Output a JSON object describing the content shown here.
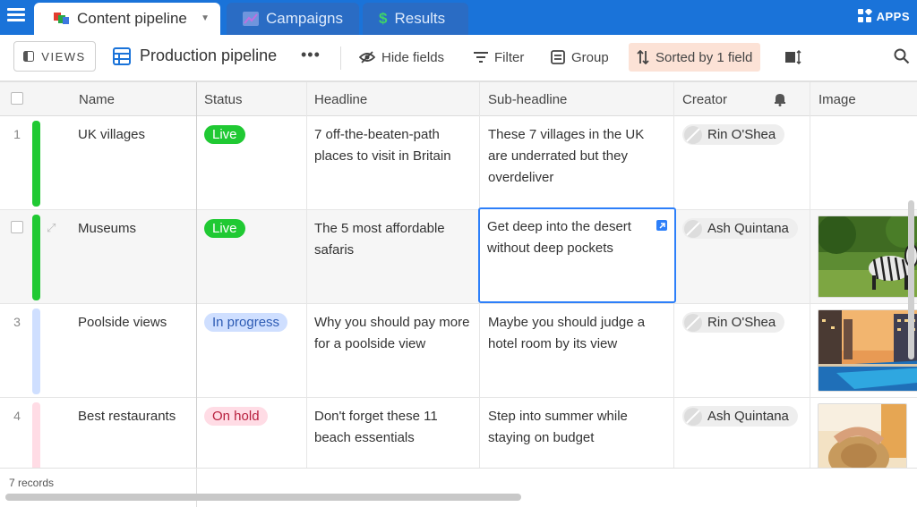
{
  "tabs": [
    {
      "label": "Content pipeline",
      "active": true,
      "icon": "colored-blocks-icon"
    },
    {
      "label": "Campaigns",
      "active": false,
      "icon": "line-chart-icon"
    },
    {
      "label": "Results",
      "active": false,
      "icon": "dollar-icon"
    }
  ],
  "apps_label": "APPS",
  "toolbar": {
    "views_label": "VIEWS",
    "view_name": "Production pipeline",
    "more": "•••",
    "hide_fields": "Hide fields",
    "filter": "Filter",
    "group": "Group",
    "sorted": "Sorted by 1 field"
  },
  "columns": [
    "Name",
    "Status",
    "Headline",
    "Sub-headline",
    "Creator",
    "Image"
  ],
  "rows": [
    {
      "num": "1",
      "name": "UK villages",
      "status": "Live",
      "headline": "7 off-the-beaten-path places to visit in Britain",
      "subheadline": "These 7 villages in the UK are underrated but they overdeliver",
      "creator": "Rin O'Shea"
    },
    {
      "num": "",
      "name": "Museums",
      "status": "Live",
      "headline": "The 5 most affordable safaris",
      "subheadline": "Get deep into the desert without deep pockets",
      "creator": "Ash Quintana"
    },
    {
      "num": "3",
      "name": "Poolside views",
      "status": "In progress",
      "headline": "Why you should pay more for a poolside view",
      "subheadline": "Maybe you should judge a hotel room by its view",
      "creator": "Rin O'Shea"
    },
    {
      "num": "4",
      "name": "Best restaurants",
      "status": "On hold",
      "headline": "Don't forget these 11 beach essentials",
      "subheadline": "Step into summer while staying on budget",
      "creator": "Ash Quintana"
    }
  ],
  "footer": {
    "records": "7 records"
  },
  "colors": {
    "accent": "#1a73d9",
    "live_bg": "#20c933",
    "live_fg": "#ffffff",
    "progress_bg": "#cfdfff",
    "progress_fg": "#2d5bb4",
    "hold_bg": "#ffdce5",
    "hold_fg": "#b8203e",
    "selection": "#2d7ff9"
  }
}
